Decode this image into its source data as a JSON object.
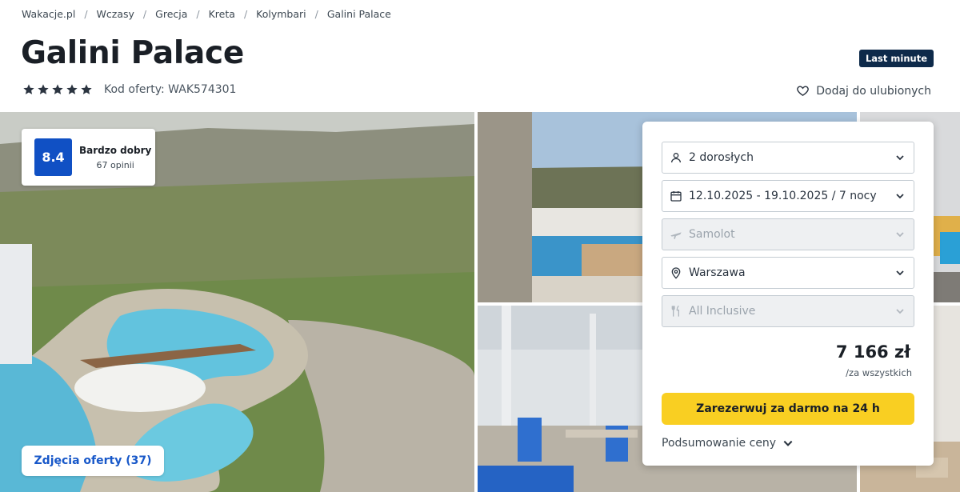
{
  "breadcrumb": [
    "Wakacje.pl",
    "Wczasy",
    "Grecja",
    "Kreta",
    "Kolymbari",
    "Galini Palace"
  ],
  "hotel": {
    "name": "Galini Palace",
    "stars": 5,
    "offer_code": "Kod oferty: WAK574301",
    "badge": "Last minute",
    "favorite_label": "Dodaj do ulubionych"
  },
  "rating": {
    "score": "8.4",
    "label": "Bardzo dobry",
    "count": "67 opinii"
  },
  "gallery": {
    "photos_button": "Zdjęcia oferty (37)"
  },
  "booking": {
    "travelers": "2 dorosłych",
    "dates": "12.10.2025 - 19.10.2025 / 7 nocy",
    "transport": "Samolot",
    "departure": "Warszawa",
    "board": "All Inclusive",
    "price": "7 166 zł",
    "price_note": "/za wszystkich",
    "reserve_label": "Zarezerwuj za darmo na 24 h",
    "summary_label": "Podsumowanie ceny"
  },
  "colors": {
    "brand_blue": "#1050c4",
    "badge_navy": "#0e2a4a",
    "cta_yellow": "#f9cf22"
  }
}
